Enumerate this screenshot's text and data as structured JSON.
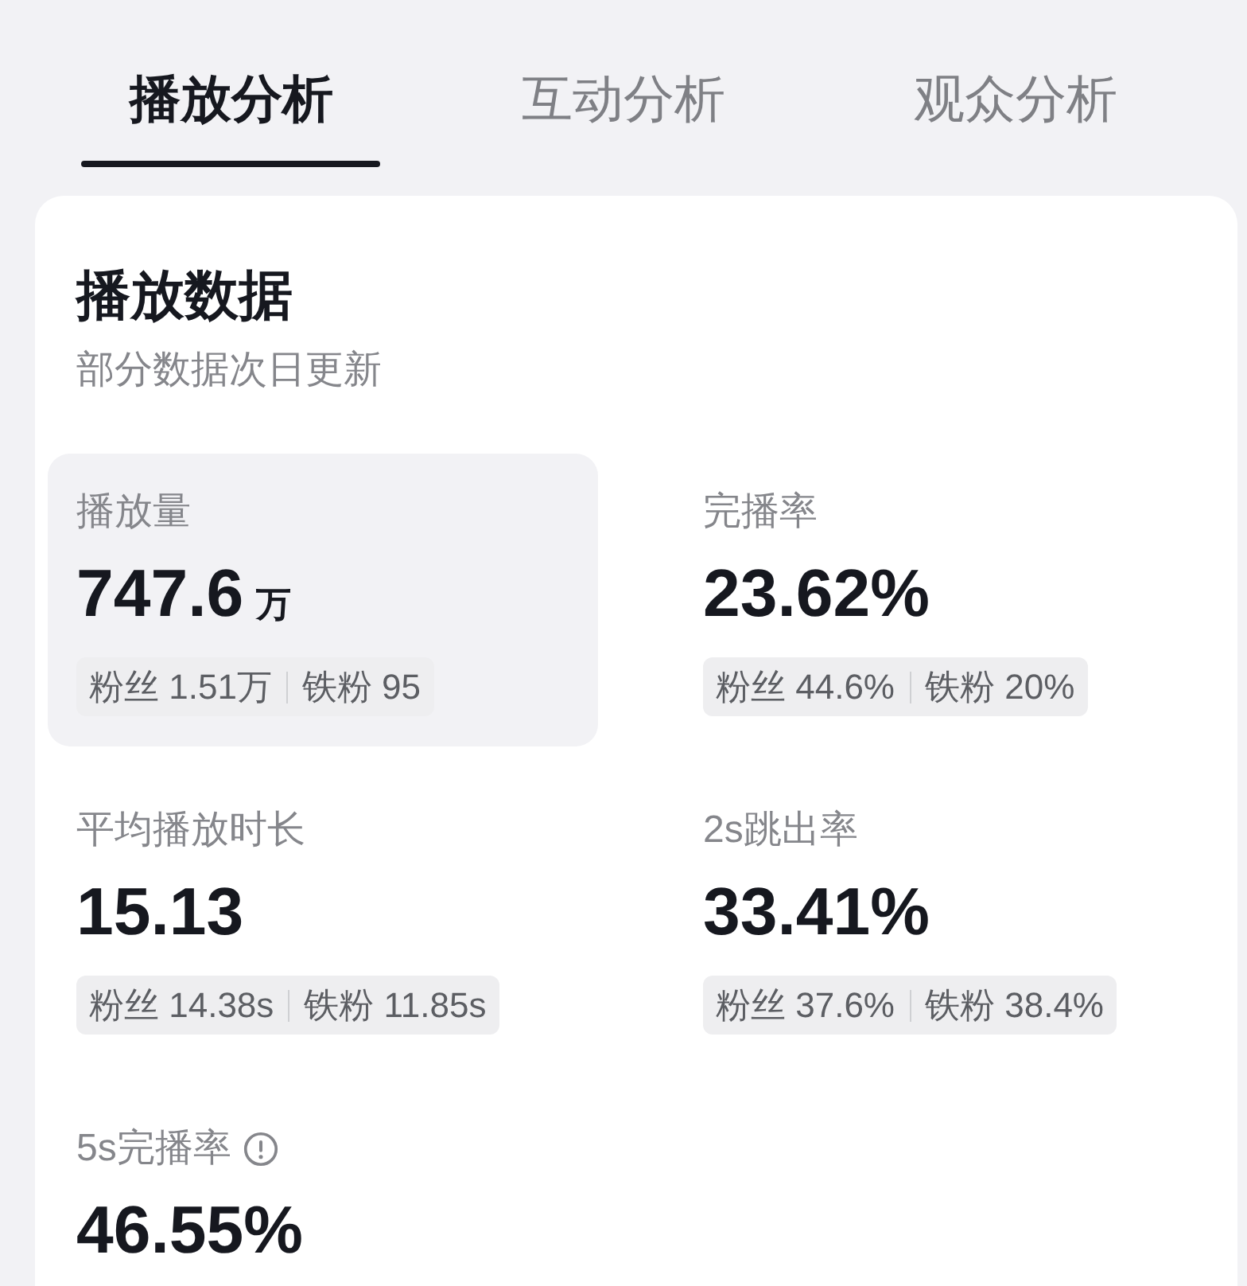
{
  "tabs": [
    {
      "label": "播放分析",
      "selected": true
    },
    {
      "label": "互动分析",
      "selected": false
    },
    {
      "label": "观众分析",
      "selected": false
    }
  ],
  "panel": {
    "title": "播放数据",
    "subtitle": "部分数据次日更新",
    "metrics": [
      {
        "label": "播放量",
        "value": "747.6",
        "unit": "万",
        "info": false,
        "selected": true,
        "breakdown": [
          "粉丝 1.51万",
          "铁粉 95"
        ]
      },
      {
        "label": "完播率",
        "value": "23.62%",
        "info": false,
        "selected": false,
        "breakdown": [
          "粉丝 44.6%",
          "铁粉 20%"
        ]
      },
      {
        "label": "平均播放时长",
        "value": "15.13",
        "info": false,
        "selected": false,
        "breakdown": [
          "粉丝 14.38s",
          "铁粉 11.85s"
        ]
      },
      {
        "label": "2s跳出率",
        "value": "33.41%",
        "info": false,
        "selected": false,
        "breakdown": [
          "粉丝 37.6%",
          "铁粉 38.4%"
        ]
      },
      {
        "label": "5s完播率",
        "value": "46.55%",
        "info": true,
        "selected": false
      }
    ]
  }
}
